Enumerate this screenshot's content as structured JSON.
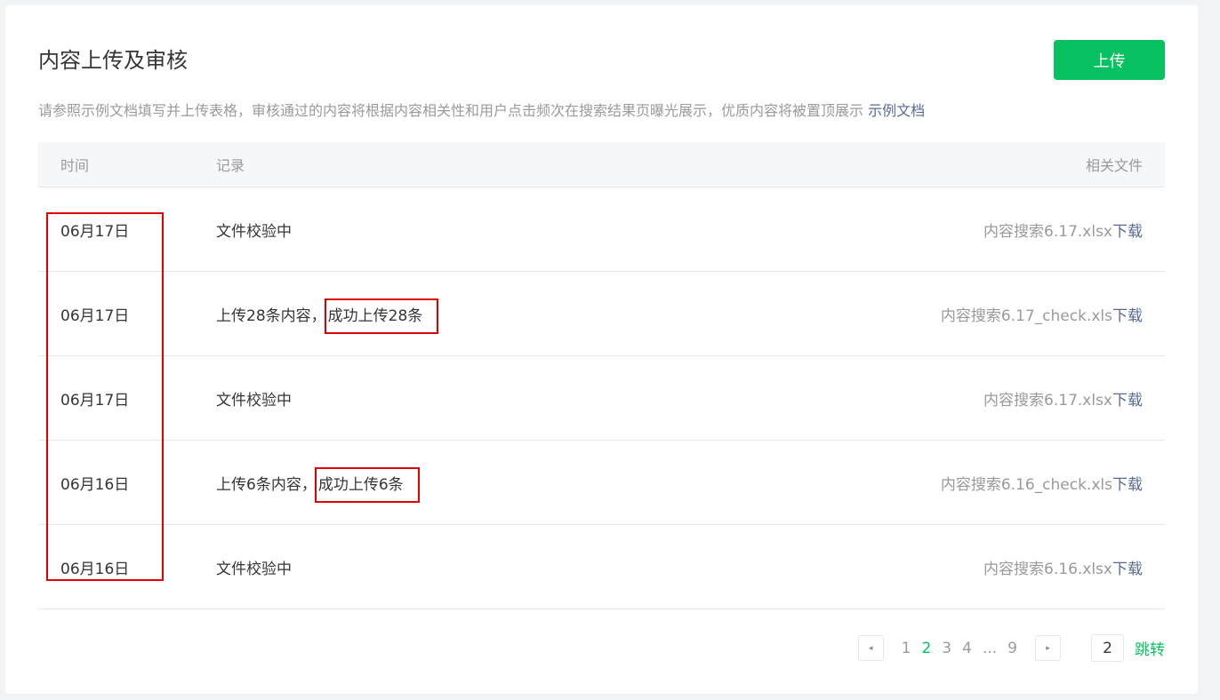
{
  "page": {
    "title": "内容上传及审核",
    "upload_label": "上传",
    "description": "请参照示例文档填写并上传表格，审核通过的内容将根据内容相关性和用户点击频次在搜索结果页曝光展示，优质内容将被置顶展示",
    "example_link": "示例文档"
  },
  "table": {
    "headers": {
      "time": "时间",
      "record": "记录",
      "file": "相关文件"
    },
    "download_label": "下载",
    "rows": [
      {
        "time": "06月17日",
        "record": "文件校验中",
        "record_highlight": "",
        "file": "内容搜索6.17.xlsx"
      },
      {
        "time": "06月17日",
        "record": "上传28条内容，",
        "record_highlight": "成功上传28条",
        "file": "内容搜索6.17_check.xls"
      },
      {
        "time": "06月17日",
        "record": "文件校验中",
        "record_highlight": "",
        "file": "内容搜索6.17.xlsx"
      },
      {
        "time": "06月16日",
        "record": "上传6条内容，",
        "record_highlight": "成功上传6条",
        "file": "内容搜索6.16_check.xls"
      },
      {
        "time": "06月16日",
        "record": "文件校验中",
        "record_highlight": "",
        "file": "内容搜索6.16.xlsx"
      }
    ]
  },
  "pagination": {
    "prev_icon": "◂",
    "next_icon": "▸",
    "pages": [
      "1",
      "2",
      "3",
      "4",
      "...",
      "9"
    ],
    "current": "2",
    "jump_value": "2",
    "jump_label": "跳转"
  },
  "colors": {
    "accent": "#07c160",
    "link": "#576b95",
    "annotation": "#e10000"
  }
}
